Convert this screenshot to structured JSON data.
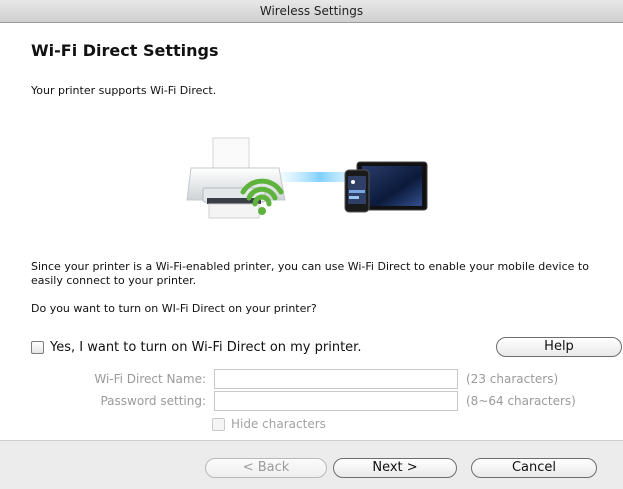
{
  "window": {
    "title": "Wireless Settings"
  },
  "heading": "Wi-Fi Direct Settings",
  "intro": "Your printer supports Wi-Fi Direct.",
  "description": "Since your printer is a Wi-Fi-enabled printer, you can use Wi-Fi Direct to enable your mobile device to easily connect to your printer.",
  "question": "Do you want to turn on WI-Fi Direct on your printer?",
  "enable_checkbox": {
    "label": "Yes, I want to turn on Wi-Fi Direct on my printer.",
    "checked": false
  },
  "help_button": "Help",
  "fields": {
    "name": {
      "label": "Wi-Fi Direct Name:",
      "value": "",
      "hint": "(23 characters)",
      "enabled": false
    },
    "password": {
      "label": "Password setting:",
      "value": "",
      "hint": "(8~64 characters)",
      "enabled": false
    }
  },
  "hide_characters": {
    "label": "Hide characters",
    "checked": false,
    "enabled": false
  },
  "buttons": {
    "back": "< Back",
    "next": "Next >",
    "cancel": "Cancel"
  },
  "icons": [
    "printer-icon",
    "wifi-icon",
    "phone-icon",
    "tablet-icon"
  ],
  "colors": {
    "wifi": "#5db33c",
    "beam": "#8fd6ff"
  }
}
